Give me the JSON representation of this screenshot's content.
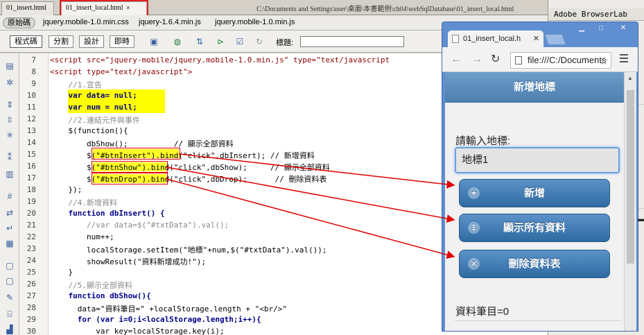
{
  "doc_tabs": [
    {
      "label": "01_insert.html"
    },
    {
      "label": "01_insert_local.html"
    }
  ],
  "doc_path": "C:\\Documents and Settings\\user\\桌面\\本書範例\\ch04\\webSqlDatabase\\01_insert_local.html",
  "related": {
    "source_label": "原始碼",
    "files": [
      "jquery.mobile-1.0.min.css",
      "jquery-1.6.4.min.js",
      "jquery.mobile-1.0.min.js"
    ]
  },
  "toolbar": {
    "views": [
      "程式碼",
      "分割",
      "設計",
      "即時"
    ],
    "title_label": "標題:",
    "title_value": ""
  },
  "right_panel": {
    "title": "Adobe BrowserLab"
  },
  "code": {
    "line_numbers": [
      "7",
      "8",
      "9",
      "10",
      "11",
      "12",
      "13",
      "14",
      "15",
      "16",
      "17",
      "18",
      "19",
      "20",
      "21",
      "22",
      "23",
      "24",
      "25",
      "26",
      "27",
      "28",
      "29",
      "30"
    ],
    "lines": [
      "<script src=\"jquery-mobile/jquery.mobile-1.0.min.js\" type=\"text/javascript",
      "<script type=\"text/javascript\">",
      "    //1.宣告",
      "    var data= null;",
      "    var num = null;",
      "    //2.連結元件與事件",
      "    $(function(){",
      "        dbShow();          // 顯示全部資料",
      "        $(\"#btnInsert\").bind(\"click\",dbInsert); // 新增資料",
      "        $(\"#btnShow\").bind(\"click\",dbShow);     // 顯示全部資料",
      "        $(\"#btnDrop\").bind(\"click\",dbDrop);      // 刪除資料表",
      "    });",
      "    //4.新增資料",
      "    function dbInsert() {",
      "        //var data=$(\"#txtData\").val();",
      "        num++;",
      "        localStorage.setItem(\"地標\"+num,$(\"#txtData\").val());",
      "        showResult(\"資料新增成功!\");",
      "    }",
      "    //5.顯示全部資料",
      "    function dbShow(){",
      "      data=\"資料筆目=\" +localStorage.length + \"<br/>\"",
      "      for (var i=0;i<localStorage.length;i++){",
      "          var key=localStorage.key(i);"
    ]
  },
  "browser": {
    "tab_title": "01_insert_local.h",
    "url": "file:///C:/Documents",
    "page": {
      "header_title": "新增地標",
      "prompt": "請輸入地標:",
      "input_value": "地標1",
      "buttons": [
        {
          "label": "新增",
          "icon": "plus-icon"
        },
        {
          "label": "顯示所有資料",
          "icon": "grid-icon"
        },
        {
          "label": "刪除資料表",
          "icon": "delete-icon"
        }
      ],
      "count_text": "資料筆目=0"
    }
  },
  "colors": {
    "highlight": "#ffff00",
    "callout": "#e00000",
    "jqm_header": "#5a8cbc",
    "jqm_button": "#3f7db4",
    "browser_frame": "#5f8fd0"
  }
}
